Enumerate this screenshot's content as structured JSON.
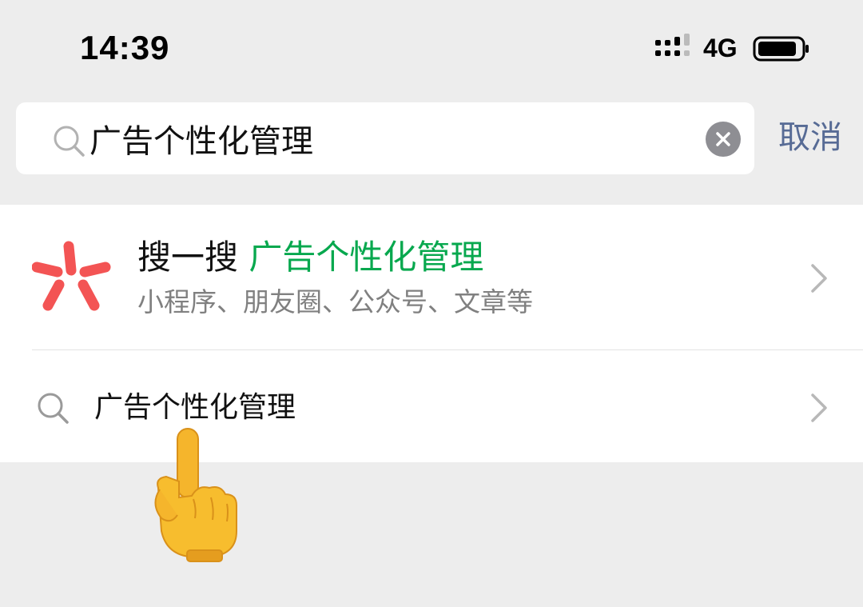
{
  "status_bar": {
    "time": "14:39",
    "network": "4G",
    "icons": [
      "signal-icon",
      "battery-icon"
    ]
  },
  "search": {
    "query": "广告个性化管理",
    "cancel_label": "取消",
    "icons": [
      "search-icon",
      "clear-icon"
    ]
  },
  "results": {
    "sousou": {
      "prefix": "搜一搜",
      "keyword": "广告个性化管理",
      "subtitle": "小程序、朋友圈、公众号、文章等",
      "icon": "sousou-logo-icon",
      "logo_color": "#f35454"
    },
    "suggestion": {
      "text": "广告个性化管理",
      "icon": "search-icon"
    }
  },
  "colors": {
    "background": "#ededed",
    "keyword_green": "#07a84e",
    "link_blue": "#576b95",
    "subtitle_gray": "#808080"
  },
  "annotation": {
    "icon": "pointing-down-hand-icon"
  }
}
